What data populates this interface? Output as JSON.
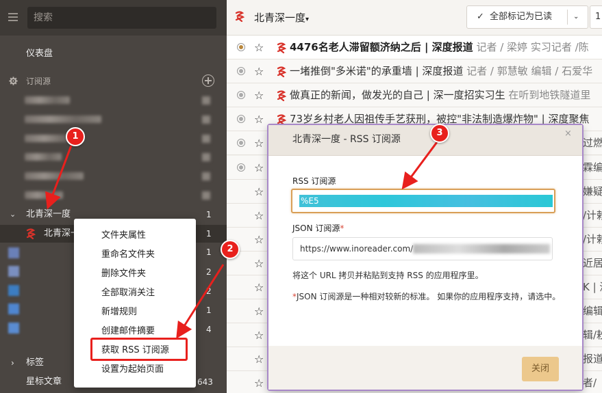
{
  "sidebar": {
    "search_placeholder": "搜索",
    "dashboard": "仪表盘",
    "subscriptions_header": "订阅源",
    "folder": {
      "label": "北青深一度",
      "count": "1"
    },
    "selected_feed": {
      "label": "北青深一",
      "count": "1"
    },
    "counts": [
      "1",
      "2",
      "2",
      "1",
      "4"
    ],
    "tags_label": "标签",
    "starred": {
      "label": "星标文章",
      "count": "643"
    }
  },
  "context_menu": {
    "items": [
      "文件夹属性",
      "重命名文件夹",
      "删除文件夹",
      "全部取消关注",
      "新增规则",
      "创建邮件摘要",
      "获取 RSS 订阅源",
      "设置为起始页面"
    ]
  },
  "topbar": {
    "feed_title": "北青深一度",
    "caret": "▾",
    "mark_all_read": "全部标记为已读",
    "extra_button": "1"
  },
  "articles": [
    {
      "title": "4476名老人滞留额济纳之后 | 深度报道",
      "meta": " 记者 / 梁婷 实习记者 /陈",
      "bold": true,
      "state": "filled",
      "trail": ""
    },
    {
      "title": "一堵推倒\"多米诺\"的承重墙 | 深度报道",
      "meta": " 记者 / 郭慧敏 编辑 / 石爱华",
      "bold": false,
      "state": "gray",
      "trail": ""
    },
    {
      "title": "做真正的新闻，做发光的自己 | 深一度招实习生",
      "meta": " 在听到地铁隧道里",
      "bold": false,
      "state": "gray",
      "trail": ""
    },
    {
      "title": "73岁乡村老人因祖传手艺获刑，被控\"非法制造爆炸物\" | 深度聚焦",
      "meta": "",
      "bold": false,
      "state": "gray",
      "trail": ""
    },
    {
      "title": "",
      "meta": "",
      "bold": false,
      "state": "gray",
      "trail": "过燃"
    },
    {
      "title": "",
      "meta": "",
      "bold": false,
      "state": "gray",
      "trail": "霖编"
    },
    {
      "title": "",
      "meta": "",
      "bold": false,
      "state": "none",
      "trail": "嫌疑人"
    },
    {
      "title": "",
      "meta": "",
      "bold": false,
      "state": "none",
      "trail": "/计赖"
    },
    {
      "title": "",
      "meta": "",
      "bold": false,
      "state": "none",
      "trail": "/计赖"
    },
    {
      "title": "",
      "meta": "",
      "bold": false,
      "state": "none",
      "trail": "近居民"
    },
    {
      "title": "",
      "meta": "",
      "bold": false,
      "state": "none",
      "trail": "K | 深"
    },
    {
      "title": "",
      "meta": "",
      "bold": false,
      "state": "none",
      "trail": "编辑"
    },
    {
      "title": "",
      "meta": "",
      "bold": false,
      "state": "none",
      "trail": "辑/耖"
    },
    {
      "title": "",
      "meta": "",
      "bold": false,
      "state": "none",
      "trail": "报道"
    },
    {
      "title": "",
      "meta": "",
      "bold": false,
      "state": "none",
      "trail": "者/"
    }
  ],
  "modal": {
    "title": "北青深一度 - RSS 订阅源",
    "close_x": "×",
    "rss_label": "RSS 订阅源",
    "rss_value_prefix": "%E5",
    "json_label": "JSON 订阅源",
    "json_req": "*",
    "json_value": "https://www.inoreader.com/",
    "help_text": "将这个 URL 拷贝并粘贴到支持 RSS 的应用程序里。",
    "note_req": "*",
    "note_text": "JSON 订阅源是一种相对较新的标准。 如果你的应用程序支持，请选中。",
    "close_button": "关闭"
  },
  "annotations": {
    "badge1": "1",
    "badge2": "2",
    "badge3": "3",
    "color": "#e8201d"
  }
}
